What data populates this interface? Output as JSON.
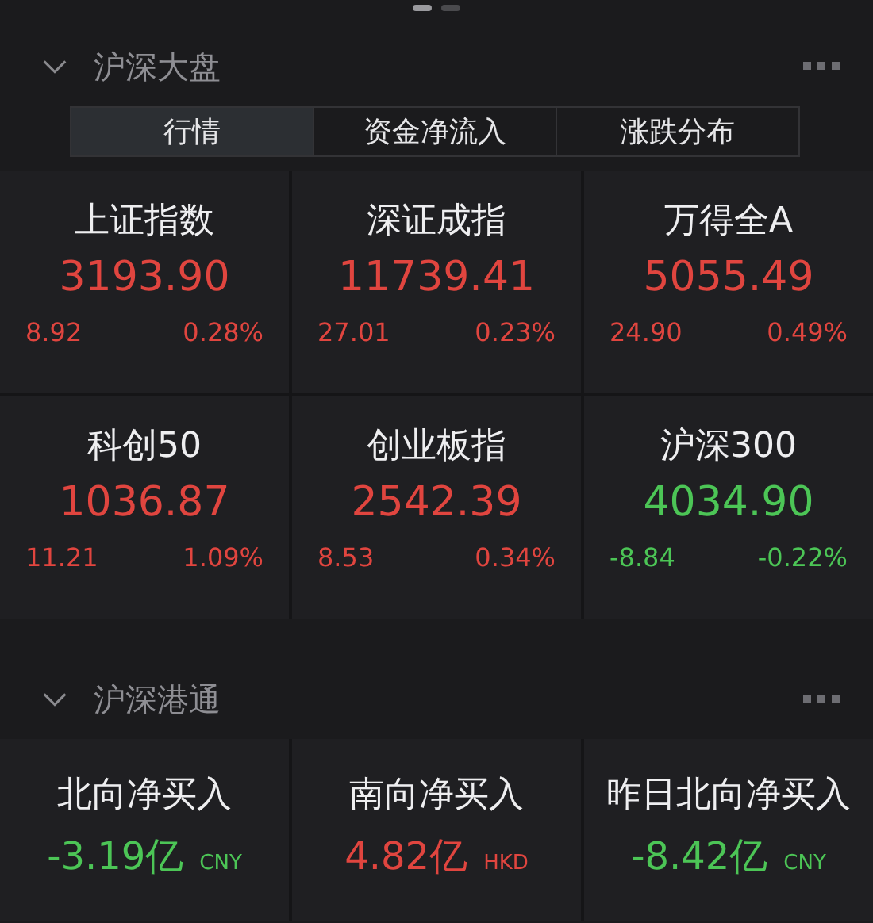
{
  "page_dots": [
    {
      "selected": true
    },
    {
      "selected": false
    }
  ],
  "sections": [
    {
      "title": "沪深大盘",
      "expanded": true,
      "tabs": [
        {
          "label": "行情",
          "selected": true
        },
        {
          "label": "资金净流入",
          "selected": false
        },
        {
          "label": "涨跌分布",
          "selected": false
        }
      ],
      "indices": [
        {
          "name": "上证指数",
          "value": "3193.90",
          "change": "8.92",
          "percent": "0.28%",
          "color": "#e0453f"
        },
        {
          "name": "深证成指",
          "value": "11739.41",
          "change": "27.01",
          "percent": "0.23%",
          "color": "#e0453f"
        },
        {
          "name": "万得全A",
          "value": "5055.49",
          "change": "24.90",
          "percent": "0.49%",
          "color": "#e0453f"
        },
        {
          "name": "科创50",
          "value": "1036.87",
          "change": "11.21",
          "percent": "1.09%",
          "color": "#e0453f"
        },
        {
          "name": "创业板指",
          "value": "2542.39",
          "change": "8.53",
          "percent": "0.34%",
          "color": "#e0453f"
        },
        {
          "name": "沪深300",
          "value": "4034.90",
          "change": "-8.84",
          "percent": "-0.22%",
          "color": "#4cc556"
        }
      ]
    },
    {
      "title": "沪深港通",
      "expanded": true,
      "flows": [
        {
          "name": "北向净买入",
          "value": "-3.19亿",
          "unit": "CNY",
          "color": "#4cc556"
        },
        {
          "name": "南向净买入",
          "value": "4.82亿",
          "unit": "HKD",
          "color": "#e0453f"
        },
        {
          "name": "昨日北向净买入",
          "value": "-8.42亿",
          "unit": "CNY",
          "color": "#4cc556"
        }
      ]
    }
  ]
}
